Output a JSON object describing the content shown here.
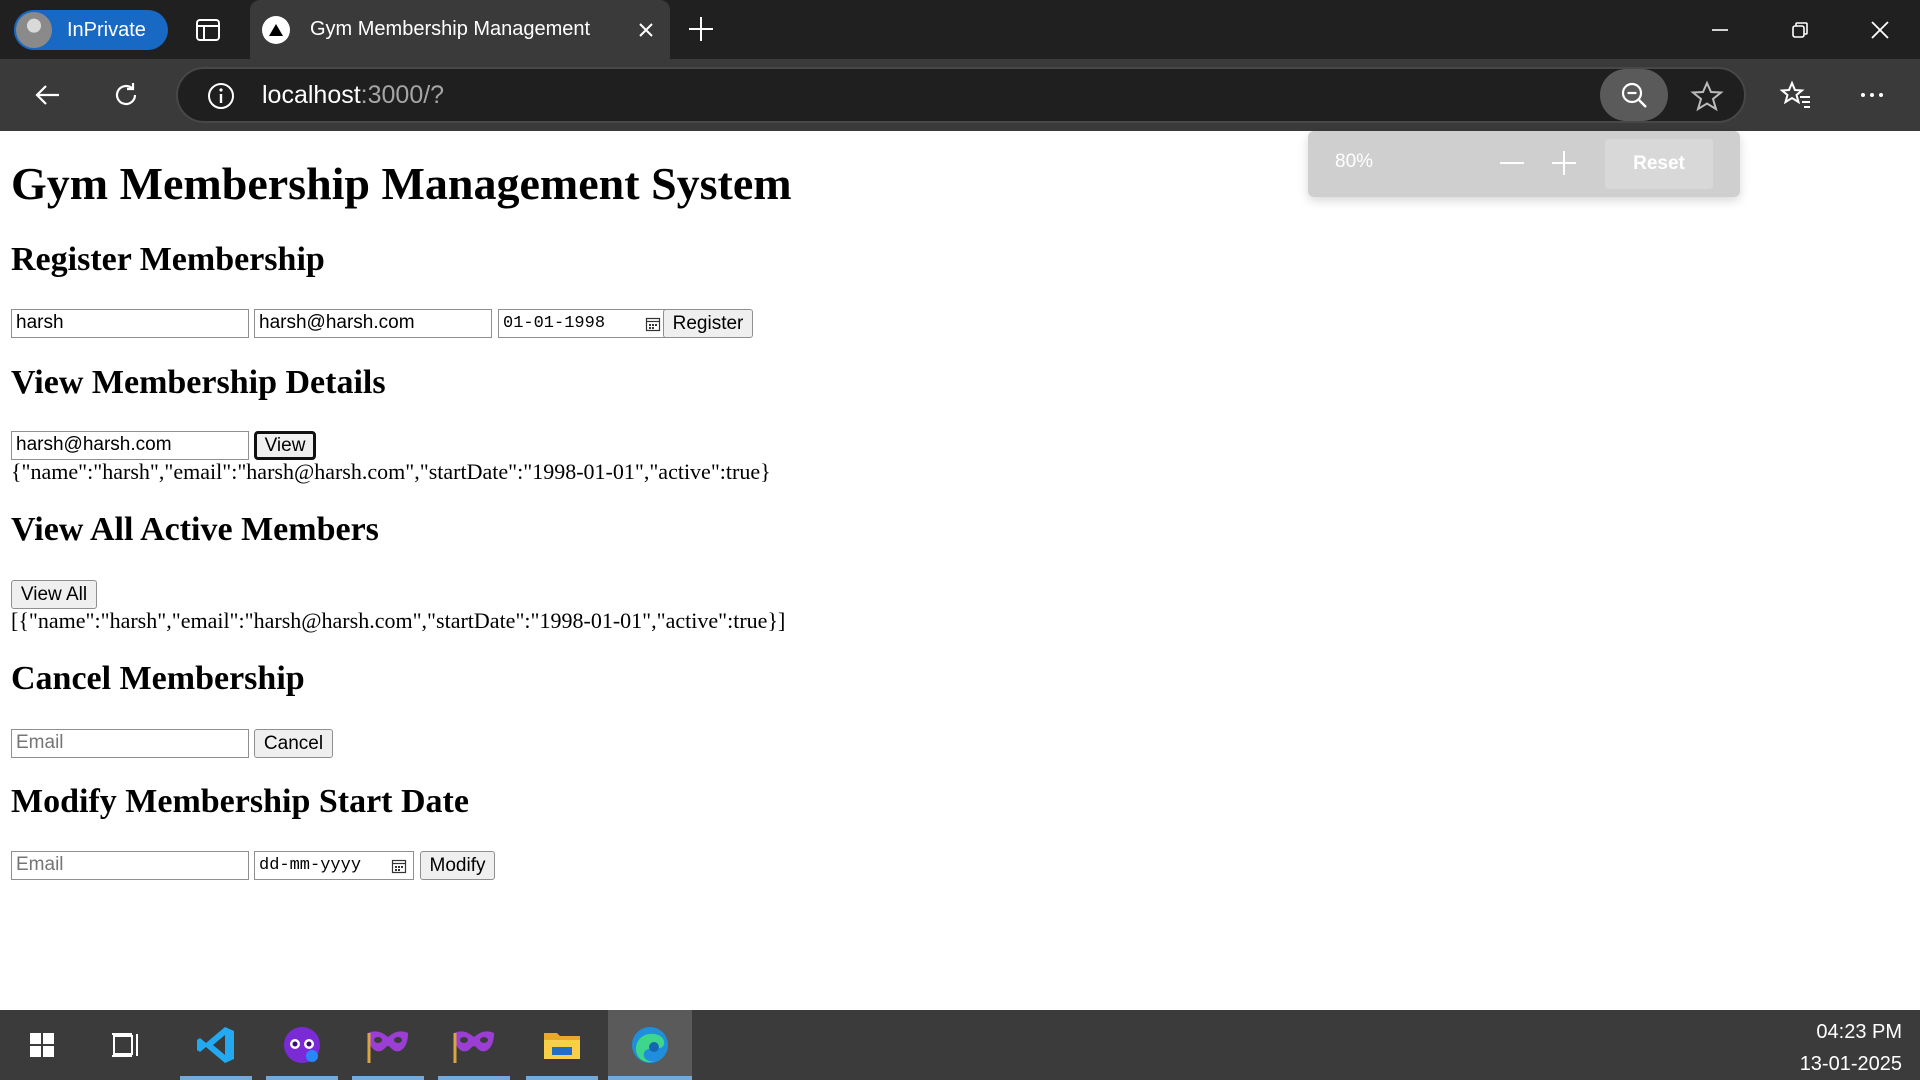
{
  "browser": {
    "inprivate_label": "InPrivate",
    "tab_title": "Gym Membership Management",
    "url_host": "localhost",
    "url_rest": ":3000/?",
    "zoom": {
      "level": "80%",
      "reset_label": "Reset"
    }
  },
  "page": {
    "title": "Gym Membership Management System",
    "register": {
      "heading": "Register Membership",
      "name_value": "harsh",
      "email_value": "harsh@harsh.com",
      "date_value": "01-01-1998",
      "button": "Register"
    },
    "view_details": {
      "heading": "View Membership Details",
      "email_value": "harsh@harsh.com",
      "button": "View",
      "result": "{\"name\":\"harsh\",\"email\":\"harsh@harsh.com\",\"startDate\":\"1998-01-01\",\"active\":true}"
    },
    "view_all": {
      "heading": "View All Active Members",
      "button": "View All",
      "result": "[{\"name\":\"harsh\",\"email\":\"harsh@harsh.com\",\"startDate\":\"1998-01-01\",\"active\":true}]"
    },
    "cancel": {
      "heading": "Cancel Membership",
      "email_placeholder": "Email",
      "button": "Cancel"
    },
    "modify": {
      "heading": "Modify Membership Start Date",
      "email_placeholder": "Email",
      "date_placeholder": "dd-mm-yyyy",
      "button": "Modify"
    }
  },
  "taskbar": {
    "apps": [
      "start-icon",
      "task-view-icon",
      "vscode-icon",
      "proxy-icon",
      "app-mask-icon",
      "app-mask-icon-2",
      "file-explorer-icon",
      "edge-icon"
    ],
    "time": "04:23 PM",
    "date": "13-01-2025"
  }
}
